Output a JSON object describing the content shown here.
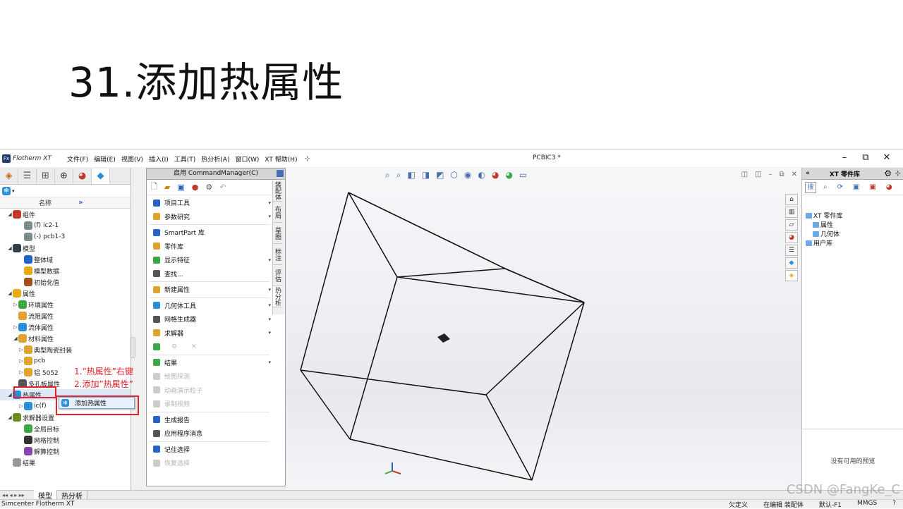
{
  "slide": {
    "title": "31.添加热属性"
  },
  "app": {
    "name": "Flotherm XT",
    "document_title": "PCBIC3 *",
    "menu": [
      "文件(F)",
      "编辑(E)",
      "视图(V)",
      "插入(I)",
      "工具(T)",
      "热分析(A)",
      "窗口(W)",
      "XT 帮助(H)"
    ],
    "window_controls": [
      "–",
      "⧉",
      "✕"
    ]
  },
  "tree": {
    "column_name": "名称",
    "column_more": "»",
    "rows": [
      {
        "label": "组件",
        "level": 0,
        "toggle": "◢",
        "color": "#c0392b"
      },
      {
        "label": "(f) ic2-1",
        "level": 2,
        "toggle": "",
        "color": "#7f8c8d"
      },
      {
        "label": "(-) pcb1-3",
        "level": 2,
        "toggle": "",
        "color": "#7f8c8d"
      },
      {
        "label": "模型",
        "level": 0,
        "toggle": "◢",
        "color": "#2c3e50"
      },
      {
        "label": "整体域",
        "level": 2,
        "toggle": "",
        "color": "#2563c9"
      },
      {
        "label": "模型数据",
        "level": 2,
        "toggle": "",
        "color": "#e6a817"
      },
      {
        "label": "初始化值",
        "level": 2,
        "toggle": "",
        "color": "#a34f1d"
      },
      {
        "label": "属性",
        "level": 0,
        "toggle": "◢",
        "color": "#e6a817"
      },
      {
        "label": "环境属性",
        "level": 1,
        "toggle": "▷",
        "color": "#3aa845"
      },
      {
        "label": "流阻属性",
        "level": 1,
        "toggle": "",
        "color": "#e0a42c"
      },
      {
        "label": "流体属性",
        "level": 1,
        "toggle": "▷",
        "color": "#2a8fd8"
      },
      {
        "label": "材料属性",
        "level": 1,
        "toggle": "◢",
        "color": "#e0a42c"
      },
      {
        "label": "典型陶瓷封装",
        "level": 2,
        "toggle": "▷",
        "color": "#e0a42c"
      },
      {
        "label": "pcb",
        "level": 2,
        "toggle": "▷",
        "color": "#e0a42c"
      },
      {
        "label": "铝 5052",
        "level": 2,
        "toggle": "▷",
        "color": "#e0a42c"
      },
      {
        "label": "多孔板属性",
        "level": 1,
        "toggle": "",
        "color": "#555555"
      },
      {
        "label": "热属性",
        "level": 0,
        "toggle": "◢",
        "color": "#2a8fd8"
      },
      {
        "label": "ic(f)",
        "level": 2,
        "toggle": "▷",
        "color": "#2a8fd8"
      },
      {
        "label": "求解器设置",
        "level": 0,
        "toggle": "◢",
        "color": "#6b8e23"
      },
      {
        "label": "全局目标",
        "level": 2,
        "toggle": "",
        "color": "#3aa845"
      },
      {
        "label": "网格控制",
        "level": 2,
        "toggle": "",
        "color": "#333333"
      },
      {
        "label": "解算控制",
        "level": 2,
        "toggle": "",
        "color": "#8e44ad"
      },
      {
        "label": "结果",
        "level": 0,
        "toggle": "",
        "color": "#999999"
      }
    ]
  },
  "context_menu": {
    "item": "添加热属性"
  },
  "annotations": {
    "step1": "1.”热属性”右键",
    "step2": "2.添加”热属性”"
  },
  "command_manager": {
    "title": "启用 CommandManager(C)",
    "items": [
      {
        "label": "项目工具",
        "arrow": true,
        "disabled": false,
        "color": "#2563c9"
      },
      {
        "label": "参数研究",
        "arrow": true,
        "disabled": false,
        "color": "#e0a42c"
      },
      {
        "sep": true
      },
      {
        "label": "SmartPart 库",
        "arrow": false,
        "disabled": false,
        "color": "#2563c9"
      },
      {
        "label": "零件库",
        "arrow": false,
        "disabled": false,
        "color": "#e0a42c"
      },
      {
        "label": "显示特征",
        "arrow": true,
        "disabled": false,
        "color": "#3aa845"
      },
      {
        "label": "查找...",
        "arrow": false,
        "disabled": false,
        "color": "#555555"
      },
      {
        "sep": true
      },
      {
        "label": "新建属性",
        "arrow": true,
        "disabled": false,
        "color": "#e0a42c"
      },
      {
        "sep": true
      },
      {
        "label": "几何体工具",
        "arrow": true,
        "disabled": false,
        "color": "#2a8fd8"
      },
      {
        "label": "网格生成器",
        "arrow": true,
        "disabled": false,
        "color": "#555555"
      },
      {
        "label": "求解器",
        "arrow": true,
        "disabled": false,
        "color": "#e0a42c"
      },
      {
        "label": "",
        "arrow": false,
        "disabled": false,
        "color": "#3aa845",
        "icons": true
      },
      {
        "sep": true
      },
      {
        "label": "结果",
        "arrow": true,
        "disabled": false,
        "color": "#3aa845"
      },
      {
        "label": "绘图探测",
        "arrow": false,
        "disabled": true,
        "color": "#cccccc"
      },
      {
        "label": "动画演示粒子",
        "arrow": false,
        "disabled": true,
        "color": "#cccccc"
      },
      {
        "label": "录制视频",
        "arrow": false,
        "disabled": true,
        "color": "#cccccc"
      },
      {
        "sep": true
      },
      {
        "label": "生成报告",
        "arrow": false,
        "disabled": false,
        "color": "#2563c9"
      },
      {
        "label": "应用程序消息",
        "arrow": false,
        "disabled": false,
        "color": "#555555"
      },
      {
        "sep": true
      },
      {
        "label": "记住选择",
        "arrow": false,
        "disabled": false,
        "color": "#2563c9"
      },
      {
        "label": "恢复选择",
        "arrow": false,
        "disabled": true,
        "color": "#cccccc"
      }
    ],
    "vertical_tabs": [
      "装配体",
      "布局",
      "草图",
      "标注",
      "评估",
      "热分析"
    ]
  },
  "library": {
    "title": "XT 零件库",
    "back": "«",
    "search_label": "搜",
    "tree": [
      {
        "label": "XT 零件库",
        "level": 0
      },
      {
        "label": "属性",
        "level": 1
      },
      {
        "label": "几何体",
        "level": 1
      },
      {
        "label": "用户库",
        "level": 0
      }
    ],
    "empty_preview": "没有可用的预览"
  },
  "bottom_tabs": [
    "模型",
    "热分析"
  ],
  "status": {
    "left": "Simcenter Flotherm XT",
    "items": [
      "欠定义",
      "在编辑 装配体",
      "默认-F1",
      "MMGS"
    ]
  },
  "watermark": "CSDN @FangKe_C"
}
